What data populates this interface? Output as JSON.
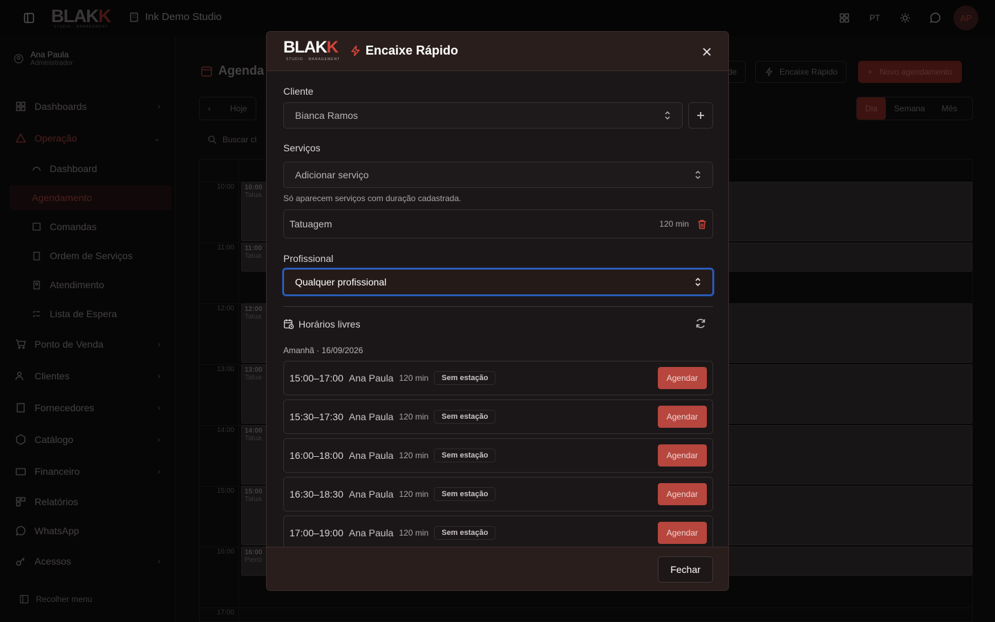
{
  "topbar": {
    "logo": "BLAK",
    "logo_k": "K",
    "logo_sub": "STUDIO · MANAGEMENT",
    "studio": "Ink Demo Studio",
    "lang": "PT",
    "avatar": "AP"
  },
  "user": {
    "name": "Ana Paula",
    "role": "Administrador"
  },
  "nav": {
    "dashboards": "Dashboards",
    "operacao": "Operação",
    "dashboard": "Dashboard",
    "agendamento": "Agendamento",
    "comandas": "Comandas",
    "ordem": "Ordem de Serviços",
    "atendimento": "Atendimento",
    "lista": "Lista de Espera",
    "ponto": "Ponto de Venda",
    "clientes": "Clientes",
    "fornecedores": "Fornecedores",
    "catalogo": "Catálogo",
    "financeiro": "Financeiro",
    "relatorios": "Relatórios",
    "whatsapp": "WhatsApp",
    "acessos": "Acessos",
    "collapse": "Recolher menu"
  },
  "page": {
    "title": "Agenda",
    "today": "Hoje",
    "search": "Buscar cl",
    "btn_partial": "de",
    "encaixe": "Encaixe Rápido",
    "novo": "Novo agendamento",
    "views": [
      "Dia",
      "Semana",
      "Mês"
    ]
  },
  "calendar": {
    "hours": [
      "10:00",
      "11:00",
      "12:00",
      "13:00",
      "14:00",
      "15:00",
      "16:00",
      "17:00"
    ],
    "events": [
      {
        "time": "10:00",
        "label": "Tatua"
      },
      {
        "time": "11:00",
        "label": "Tatua"
      },
      {
        "time": "12:00",
        "label": "Tatua"
      },
      {
        "time": "13:00",
        "label": "Tatua"
      },
      {
        "time": "14:00",
        "label": "Tatua"
      },
      {
        "time": "15:00",
        "label": "Tatua"
      },
      {
        "time": "16:00",
        "label": "Pierci"
      }
    ]
  },
  "modal": {
    "logo": "BLAK",
    "logo_k": "K",
    "logo_sub": "STUDIO · MANAGEMENT",
    "title": "Encaixe Rápido",
    "cliente_label": "Cliente",
    "cliente_value": "Bianca Ramos",
    "servicos_label": "Serviços",
    "servicos_placeholder": "Adicionar serviço",
    "servicos_hint": "Só aparecem serviços com duração cadastrada.",
    "service": {
      "name": "Tatuagem",
      "duration": "120 min"
    },
    "profissional_label": "Profissional",
    "profissional_value": "Qualquer profissional",
    "slots_title": "Horários livres",
    "date_label": "Amanhã · 16/09/2026",
    "slots": [
      {
        "time": "15:00–17:00",
        "pro": "Ana Paula",
        "dur": "120 min",
        "station": "Sem estação",
        "action": "Agendar"
      },
      {
        "time": "15:30–17:30",
        "pro": "Ana Paula",
        "dur": "120 min",
        "station": "Sem estação",
        "action": "Agendar"
      },
      {
        "time": "16:00–18:00",
        "pro": "Ana Paula",
        "dur": "120 min",
        "station": "Sem estação",
        "action": "Agendar"
      },
      {
        "time": "16:30–18:30",
        "pro": "Ana Paula",
        "dur": "120 min",
        "station": "Sem estação",
        "action": "Agendar"
      },
      {
        "time": "17:00–19:00",
        "pro": "Ana Paula",
        "dur": "120 min",
        "station": "Sem estação",
        "action": "Agendar"
      }
    ],
    "close_label": "Fechar"
  },
  "colors": {
    "accent": "#d4453a",
    "focus": "#2e63c6",
    "button": "#b6463e"
  }
}
